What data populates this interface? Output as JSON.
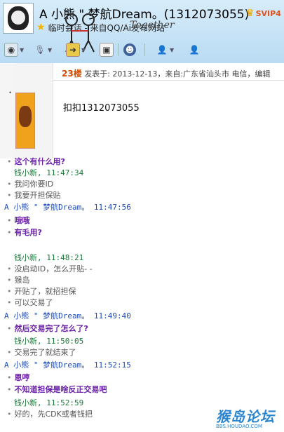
{
  "header": {
    "title": "A 小熊 \" 梦航Dream。(1312073055)",
    "vip_label": "SVIP4",
    "subtitle": "临时会话 - 来自QQ/Ai发布网站",
    "signature": "Together"
  },
  "toolbar": {
    "icons": [
      "video-call-icon",
      "voice-call-icon",
      "doodle-icon",
      "send-file-icon",
      "app-box-icon",
      "police-icon",
      "remote-assist-icon",
      "add-friend-icon"
    ]
  },
  "embedded_post": {
    "floor": "23楼",
    "meta": "发表于: 2013-12-13，来自:广东省汕头市 电信，编辑",
    "body": "扣扣1312073055"
  },
  "chat": [
    {
      "kind": "bold",
      "text": "这个有什么用?"
    },
    {
      "kind": "me",
      "text": "钱小新,   11:47:34"
    },
    {
      "kind": "norm",
      "text": "我问你要ID"
    },
    {
      "kind": "norm",
      "text": "我要开担保贴"
    },
    {
      "kind": "them",
      "text": "A 小熊 \" 梦航Dream。  11:47:56"
    },
    {
      "kind": "bold",
      "text": "哦哦"
    },
    {
      "kind": "bold",
      "text": "有毛用?"
    },
    {
      "kind": "me",
      "text": "钱小新,   11:48:21"
    },
    {
      "kind": "norm",
      "text": "没启动ID，怎么开贴- -"
    },
    {
      "kind": "norm",
      "text": "猴岛"
    },
    {
      "kind": "norm",
      "text": "开贴了，就招担保"
    },
    {
      "kind": "norm",
      "text": "可以交易了"
    },
    {
      "kind": "them",
      "text": "A 小熊 \" 梦航Dream。  11:49:40"
    },
    {
      "kind": "bold",
      "text": "然后交易完了怎么了?"
    },
    {
      "kind": "me",
      "text": "钱小新,   11:50:05"
    },
    {
      "kind": "norm",
      "text": "交易完了就结束了"
    },
    {
      "kind": "them",
      "text": "A 小熊 \" 梦航Dream。  11:52:15"
    },
    {
      "kind": "bold",
      "text": "恩哼"
    },
    {
      "kind": "bold",
      "text": "不知道担保是啥反正交易吧"
    },
    {
      "kind": "me",
      "text": "钱小新,   11:52:59"
    },
    {
      "kind": "norm",
      "text": "好的，先CDK或者钱把"
    }
  ],
  "watermark": {
    "title": "猴岛论坛",
    "url": "BBS.HOUDAO.COM"
  }
}
